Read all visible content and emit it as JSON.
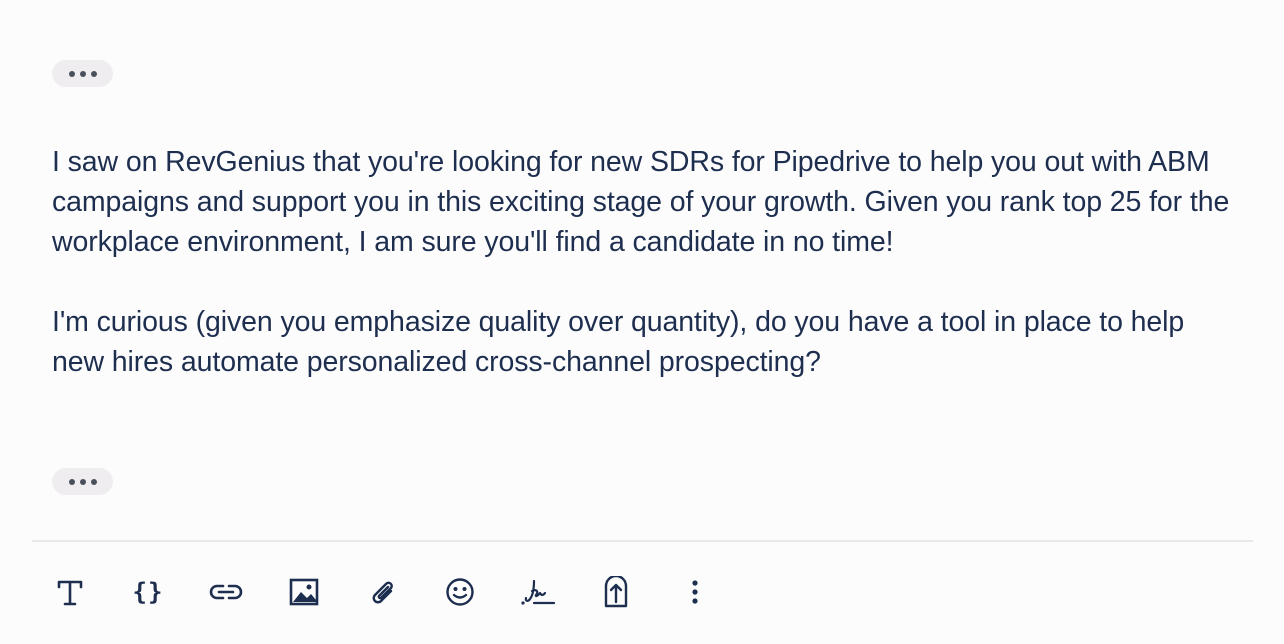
{
  "composer": {
    "collapsed_quote_top": "show-trimmed-content",
    "paragraphs": [
      "I saw on RevGenius that you're looking for new SDRs for Pipedrive to help you out with ABM campaigns and support you in this exciting stage of your growth. Given you rank top 25 for the workplace environment, I am sure you'll find a candidate in no time!",
      "I'm curious (given you emphasize quality over quantity), do you have a tool in place to help new hires automate personalized cross-channel prospecting?"
    ],
    "collapsed_quote_bottom": "show-trimmed-content"
  },
  "toolbar": {
    "items": [
      {
        "icon": "text-format-icon"
      },
      {
        "icon": "variables-icon",
        "glyph": "{}"
      },
      {
        "icon": "link-icon"
      },
      {
        "icon": "image-icon"
      },
      {
        "icon": "attachment-icon"
      },
      {
        "icon": "emoji-icon"
      },
      {
        "icon": "signature-icon"
      },
      {
        "icon": "upload-icon"
      },
      {
        "icon": "more-options-icon"
      }
    ]
  },
  "colors": {
    "text": "#1d2e4f",
    "pill_background": "#efedf0",
    "divider": "#e8e8ea",
    "page_background": "#fdfcfd"
  }
}
